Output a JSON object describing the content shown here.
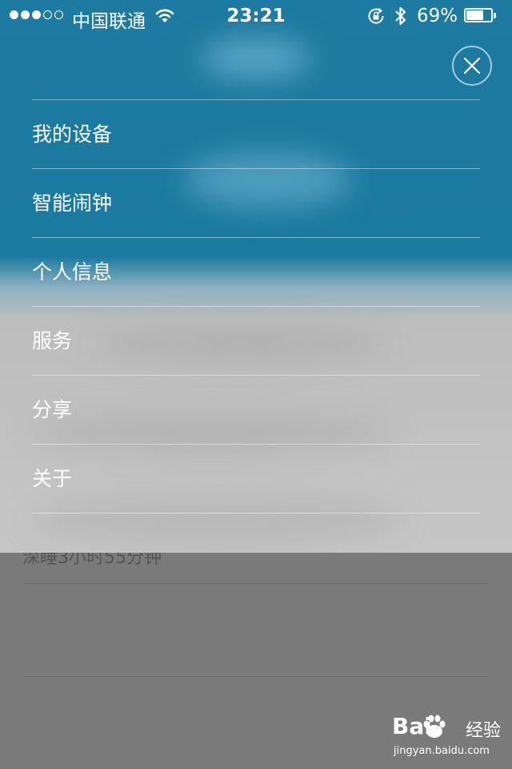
{
  "status_bar": {
    "carrier": "中国联通",
    "time": "23:21",
    "battery_text": "69%",
    "battery_level": 0.69,
    "signal_bars_filled": 3,
    "signal_bars_total": 5
  },
  "background": {
    "sleep_text": "深睡3小时55分钟"
  },
  "menu": {
    "items": [
      {
        "label": "我的设备"
      },
      {
        "label": "智能闹钟"
      },
      {
        "label": "个人信息"
      },
      {
        "label": "服务"
      },
      {
        "label": "分享"
      },
      {
        "label": "关于"
      }
    ]
  },
  "watermark": {
    "logo_left": "Bai",
    "logo_right": "经验",
    "url": "jingyan.baidu.com"
  },
  "colors": {
    "overlay_top": "#1d7aa0",
    "overlay_bottom": "#c6c6c6",
    "dim_background": "#7a7a7a"
  }
}
